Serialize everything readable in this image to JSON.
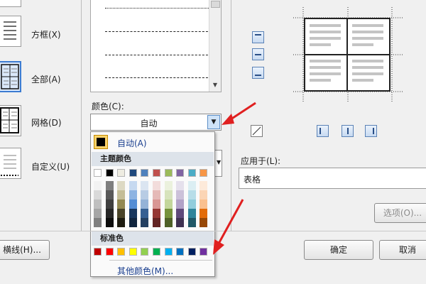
{
  "settings": {
    "box_label": "方框(X)",
    "all_label": "全部(A)",
    "grid_label": "网格(D)",
    "custom_label": "自定义(U)"
  },
  "color": {
    "label": "颜色(C):",
    "value": "自动"
  },
  "popup": {
    "auto_label": "自动(A)",
    "theme_header": "主题颜色",
    "standard_header": "标准色",
    "more_label": "其他颜色(M)...",
    "theme_top": [
      "#ffffff",
      "#000000",
      "#eeece1",
      "#1f497d",
      "#4f81bd",
      "#c0504d",
      "#9bbb59",
      "#8064a2",
      "#4bacc6",
      "#f79646"
    ],
    "theme_shades": [
      [
        "#f2f2f2",
        "#d9d9d9",
        "#bfbfbf",
        "#a6a6a6",
        "#808080"
      ],
      [
        "#7f7f7f",
        "#595959",
        "#3f3f3f",
        "#262626",
        "#0d0d0d"
      ],
      [
        "#ddd9c3",
        "#c4bd97",
        "#938953",
        "#494429",
        "#1d1b10"
      ],
      [
        "#c6d9f0",
        "#8db3e2",
        "#548dd4",
        "#17365d",
        "#0f243e"
      ],
      [
        "#dbe5f1",
        "#b8cce4",
        "#95b3d7",
        "#366092",
        "#244061"
      ],
      [
        "#f2dcdb",
        "#e5b9b7",
        "#d99694",
        "#953734",
        "#632423"
      ],
      [
        "#ebf1dd",
        "#d7e3bc",
        "#c3d69b",
        "#76923c",
        "#4f6128"
      ],
      [
        "#e5e0ec",
        "#ccc1d9",
        "#b2a2c7",
        "#5f497a",
        "#3f3151"
      ],
      [
        "#dbeef3",
        "#b7dde8",
        "#92cddc",
        "#31859b",
        "#205867"
      ],
      [
        "#fdeada",
        "#fbd5b5",
        "#fac08f",
        "#e36c09",
        "#974806"
      ]
    ],
    "standard": [
      "#c00000",
      "#ff0000",
      "#ffc000",
      "#ffff00",
      "#92d050",
      "#00b050",
      "#00b0f0",
      "#0070c0",
      "#002060",
      "#7030a0"
    ]
  },
  "apply": {
    "label": "应用于(L):",
    "value": "表格"
  },
  "buttons": {
    "options_label": "选项(O)...",
    "horizontal_line_label": "横线(H)...",
    "ok_label": "确定",
    "cancel_label": "取消"
  },
  "icons": [
    "border-top-icon",
    "border-middle-icon",
    "border-bottom-icon",
    "diagonal-icon",
    "border-left-icon",
    "border-center-icon",
    "border-right-icon",
    "dropdown-arrow-icon"
  ],
  "accent_colors": {
    "selection": "#3b7bd1",
    "annotation_arrow": "#e02020"
  }
}
